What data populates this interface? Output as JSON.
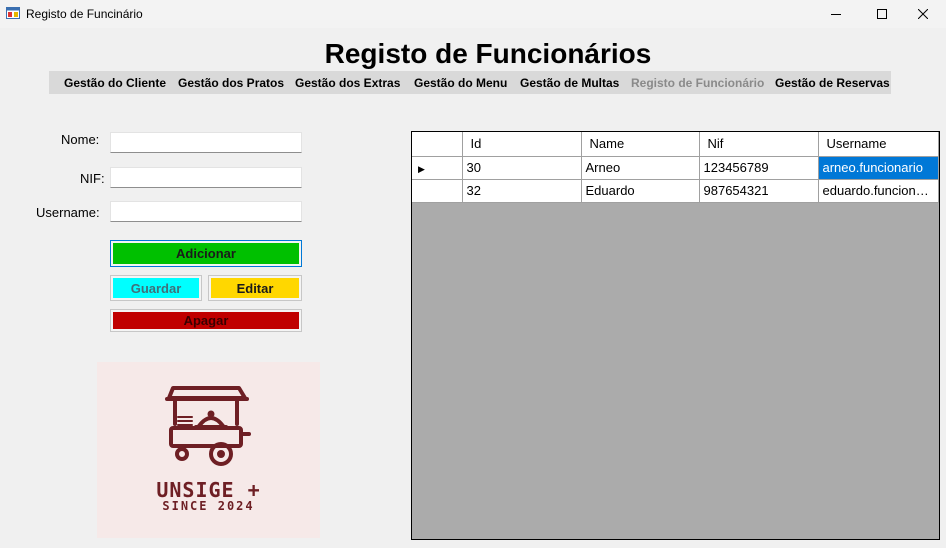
{
  "window": {
    "title": "Registo de Funcinário"
  },
  "page": {
    "title": "Registo de Funcionários"
  },
  "menu": {
    "items": [
      {
        "label": "Gestão do Cliente"
      },
      {
        "label": "Gestão dos Pratos"
      },
      {
        "label": "Gestão dos Extras"
      },
      {
        "label": "Gestão do Menu"
      },
      {
        "label": "Gestão de Multas"
      },
      {
        "label": "Registo de Funcionário",
        "disabled": true
      },
      {
        "label": "Gestão de Reservas"
      }
    ]
  },
  "form": {
    "nome_label": "Nome:",
    "nif_label": "NIF:",
    "username_label": "Username:",
    "nome_value": "",
    "nif_value": "",
    "username_value": ""
  },
  "buttons": {
    "add": "Adicionar",
    "save": "Guardar",
    "edit": "Editar",
    "delete": "Apagar"
  },
  "logo": {
    "name": "UNSIGE +",
    "since": "SINCE 2024"
  },
  "grid": {
    "columns": [
      "Id",
      "Name",
      "Nif",
      "Username"
    ],
    "rows": [
      {
        "id": "30",
        "name": "Arneo",
        "nif": "123456789",
        "username": "arneo.funcionario",
        "current": true
      },
      {
        "id": "32",
        "name": "Eduardo",
        "nif": "987654321",
        "username": "eduardo.funcionario",
        "current": false
      }
    ]
  },
  "colors": {
    "add": "#00c000",
    "save": "#00ffff",
    "edit": "#ffd700",
    "delete": "#c00000",
    "selection": "#0078d7",
    "logo": "#6e1f24"
  }
}
